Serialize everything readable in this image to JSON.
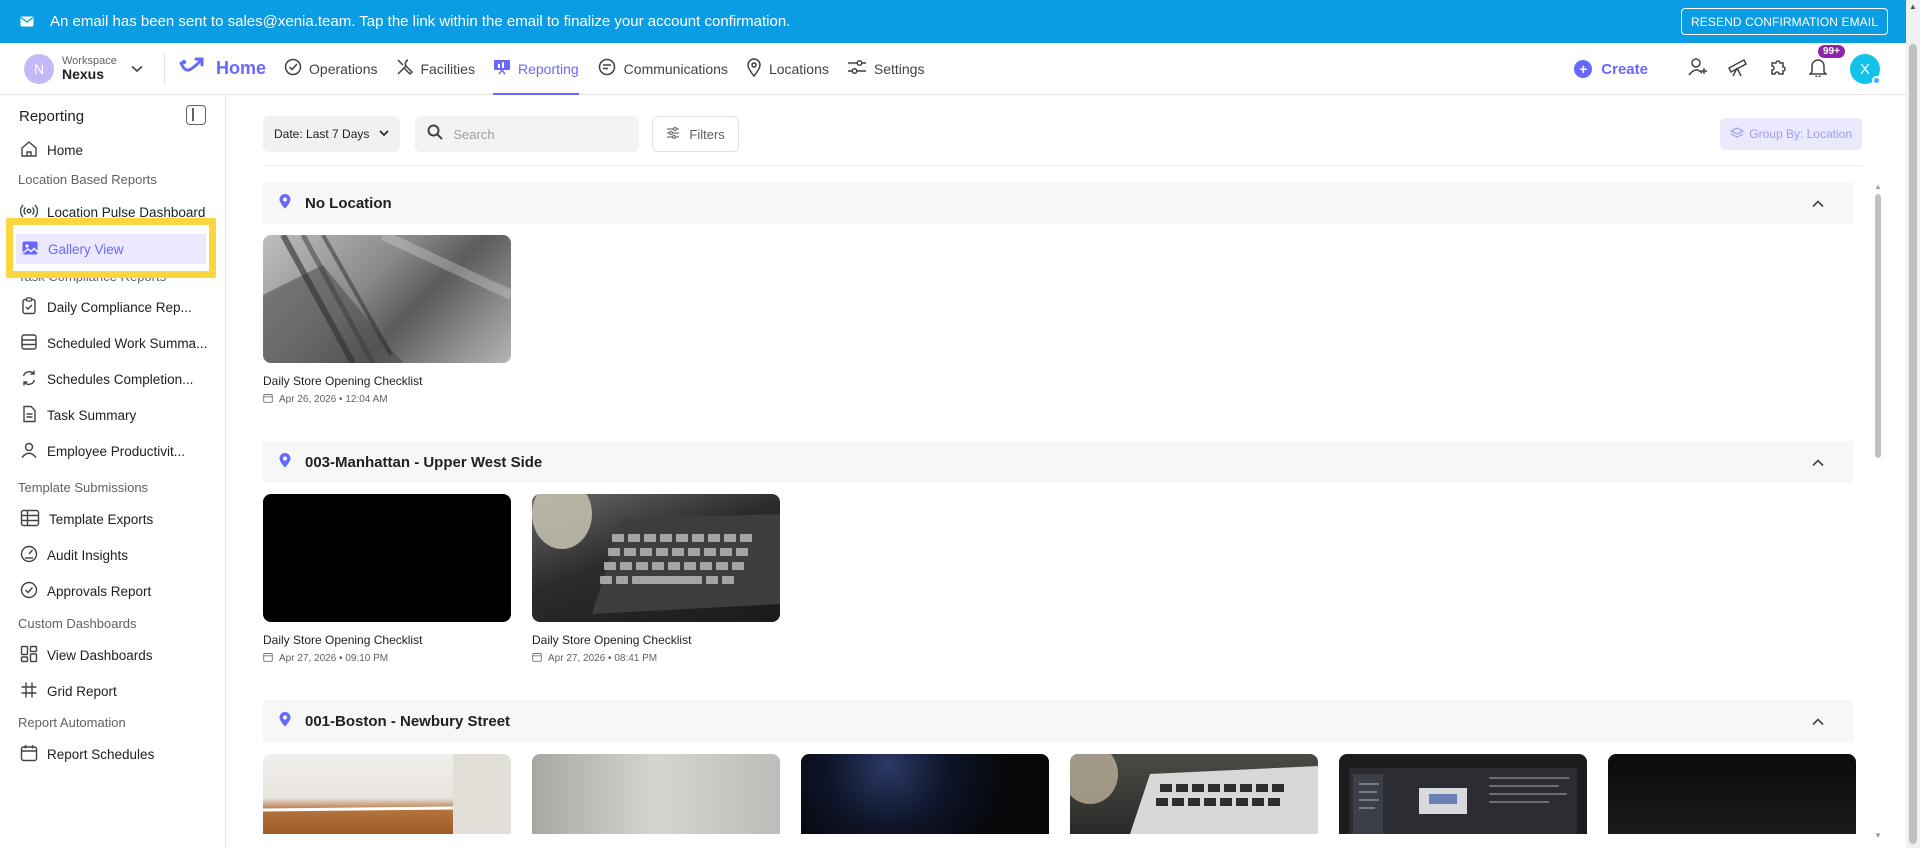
{
  "banner": {
    "message": "An email has been sent to sales@xenia.team. Tap the link within the email to finalize your account confirmation.",
    "resend_label": "RESEND CONFIRMATION EMAIL",
    "color": "#0b9de4"
  },
  "workspace": {
    "avatar_letter": "N",
    "label": "Workspace",
    "name": "Nexus"
  },
  "nav": {
    "home": "Home",
    "items": [
      {
        "label": "Operations",
        "icon": "check-circle-icon"
      },
      {
        "label": "Facilities",
        "icon": "tools-icon"
      },
      {
        "label": "Reporting",
        "icon": "presentation-chart-icon",
        "active": true
      },
      {
        "label": "Communications",
        "icon": "chat-icon"
      },
      {
        "label": "Locations",
        "icon": "map-pin-icon"
      },
      {
        "label": "Settings",
        "icon": "sliders-icon"
      }
    ],
    "create_label": "Create",
    "notification_badge": "99+",
    "user_avatar_letter": "X",
    "accent": "#6868fe"
  },
  "sidebar": {
    "title": "Reporting",
    "home": "Home",
    "sections": {
      "location_based": "Location Based Reports",
      "task_compliance": "Task Compliance Reports",
      "template_submissions": "Template Submissions",
      "custom_dashboards": "Custom Dashboards",
      "report_automation": "Report Automation"
    },
    "items": {
      "location_pulse": "Location Pulse Dashboard",
      "gallery_view": "Gallery View",
      "daily_compliance": "Daily Compliance Rep...",
      "scheduled_work": "Scheduled Work Summa...",
      "schedules_completion": "Schedules Completion...",
      "task_summary": "Task Summary",
      "employee_productivity": "Employee Productivit...",
      "template_exports": "Template Exports",
      "audit_insights": "Audit Insights",
      "approvals_report": "Approvals Report",
      "view_dashboards": "View Dashboards",
      "grid_report": "Grid Report",
      "report_schedules": "Report Schedules"
    }
  },
  "toolbar": {
    "date_label": "Date: Last 7 Days",
    "search_placeholder": "Search",
    "filters_label": "Filters",
    "group_by_label": "Group By: Location"
  },
  "groups": [
    {
      "name": "No Location",
      "cards": [
        {
          "title": "Daily Store Opening Checklist",
          "date": "Apr 26, 2026 • 12:04 AM"
        }
      ]
    },
    {
      "name": "003-Manhattan - Upper West Side",
      "cards": [
        {
          "title": "Daily Store Opening Checklist",
          "date": "Apr 27, 2026 • 09:10 PM"
        },
        {
          "title": "Daily Store Opening Checklist",
          "date": "Apr 27, 2026 • 08:41 PM"
        }
      ]
    },
    {
      "name": "001-Boston - Newbury Street",
      "cards": []
    }
  ]
}
